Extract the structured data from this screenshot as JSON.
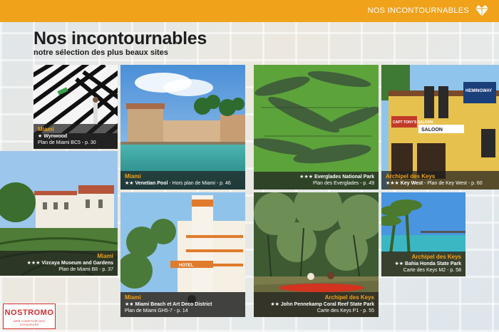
{
  "header": {
    "section_label": "NOS INCONTOURNABLES",
    "section_icon": "heart-diamond-icon",
    "accent_color": "#f0a21b"
  },
  "page": {
    "title": "Nos incontournables",
    "subtitle": "notre sélection des plus beaux sites"
  },
  "cards": [
    {
      "region": "Miami",
      "stars": "★",
      "name": "Wynwood",
      "ref": "Plan de Miami BC5 - p. 30"
    },
    {
      "region": "Miami",
      "stars": "★★",
      "name": "Venetian Pool",
      "ref": " - Hors plan de Miami - p. 46"
    },
    {
      "region": "",
      "stars": "★★★",
      "name": "Everglades National Park",
      "ref": "Plan des Everglades - p. 49"
    },
    {
      "region": "Archipel des Keys",
      "stars": "★★★",
      "name": "Key West",
      "ref": " - Plan de Key West - p. 60"
    },
    {
      "region": "Miami",
      "stars": "★★★",
      "name": "Vizcaya Museum and Gardens",
      "ref": "Plan de Miami B8 - p. 37"
    },
    {
      "region": "Miami",
      "stars": "★★",
      "name": "Miami Beach et Art Deco District",
      "ref": "Plan de Miami GH5-7 - p. 14"
    },
    {
      "region": "Archipel des Keys",
      "stars": "★★",
      "name": "John Pennekamp Coral Reef State Park",
      "ref": "Carte des Keys P1 - p. 55"
    },
    {
      "region": "Archipel des Keys",
      "stars": "★★",
      "name": "Bahia Honda State Park",
      "ref": "Carte des Keys M2 - p. 58"
    }
  ],
  "signs": {
    "hemingway": "HEMINGWAY",
    "captain_tonys": "CAPT TONY'S SALOON",
    "saloon": "SALOON",
    "hotel": "HOTEL"
  },
  "logo": {
    "name": "NOSTROMO",
    "tagline": "WEB COMPTOIR DES VOYAGEURS"
  }
}
